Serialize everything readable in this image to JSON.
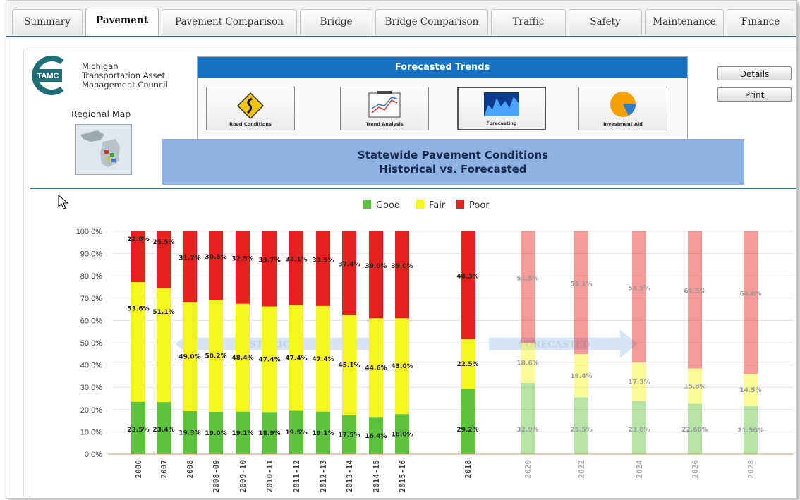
{
  "tabs": [
    "Summary",
    "Pavement",
    "Pavement Comparison",
    "Bridge",
    "Bridge Comparison",
    "Traffic",
    "Safety",
    "Maintenance",
    "Finance"
  ],
  "active_tab": "Pavement",
  "org": {
    "logo_text": "TAMC",
    "line1": "Michigan",
    "line2": "Transportation Asset",
    "line3": "Management Council"
  },
  "regional_map_label": "Regional Map",
  "trends": {
    "title": "Forecasted Trends",
    "buttons": [
      "Road Conditions",
      "Trend Analysis",
      "Forecasting",
      "Investment Aid"
    ]
  },
  "buttons": {
    "details": "Details",
    "print": "Print"
  },
  "statewide": {
    "line1": "Statewide Pavement Conditions",
    "line2": "Historical vs. Forecasted"
  },
  "colors": {
    "good": "#5cc43a",
    "fair": "#f6f61e",
    "poor": "#e8211f",
    "tab_accent": "#2d6b7c",
    "trend_header": "#1471c2",
    "state_bar": "#8fb3e3"
  },
  "chart_data": {
    "type": "bar",
    "stacked": true,
    "categories": [
      "2006",
      "2007",
      "2008",
      "2008-09",
      "2009-10",
      "2010-11",
      "2011-12",
      "2012-13",
      "2013-14",
      "2014-15",
      "2015-16",
      "2018",
      "2020",
      "2022",
      "2024",
      "2026",
      "2028"
    ],
    "series": [
      {
        "name": "Good",
        "values": [
          23.5,
          23.4,
          19.3,
          19.0,
          19.1,
          18.9,
          19.5,
          19.1,
          17.5,
          16.4,
          18.0,
          29.2,
          32.9,
          25.5,
          23.8,
          22.6,
          21.5
        ]
      },
      {
        "name": "Fair",
        "values": [
          53.6,
          51.1,
          49.0,
          50.2,
          48.4,
          47.4,
          47.4,
          47.4,
          45.1,
          44.6,
          43.0,
          22.5,
          18.6,
          19.4,
          17.3,
          15.8,
          14.5
        ]
      },
      {
        "name": "Poor",
        "values": [
          22.8,
          25.5,
          31.7,
          30.8,
          32.5,
          33.7,
          33.1,
          33.5,
          37.4,
          39.0,
          39.0,
          48.3,
          51.5,
          55.1,
          58.9,
          61.5,
          64.0
        ]
      }
    ],
    "value_labels": {
      "Good": [
        "23.5%",
        "23.4%",
        "19.3%",
        "19.0%",
        "19.1%",
        "18.9%",
        "19.5%",
        "19.1%",
        "17.5%",
        "16.4%",
        "18.0%",
        "29.2%",
        "32.9%",
        "25.5%",
        "23.8%",
        "22.60%",
        "21.50%"
      ],
      "Fair": [
        "53.6%",
        "51.1%",
        "49.0%",
        "50.2%",
        "48.4%",
        "47.4%",
        "47.4%",
        "47.4%",
        "45.1%",
        "44.6%",
        "43.0%",
        "22.5%",
        "18.6%",
        "19.4%",
        "17.3%",
        "15.8%",
        "14.5%"
      ],
      "Poor": [
        "22.8%",
        "25.5%",
        "31.7%",
        "30.8%",
        "32.5%",
        "33.7%",
        "33.1%",
        "33.5%",
        "37.4%",
        "39.0%",
        "39.0%",
        "48.3%",
        "51.5%",
        "55.1%",
        "58.9%",
        "61.5%",
        "64.0%"
      ]
    },
    "forecast_start_index": 12,
    "ylim": [
      0,
      100
    ],
    "yticks": [
      "0.0%",
      "10.0%",
      "20.0%",
      "30.0%",
      "40.0%",
      "50.0%",
      "60.0%",
      "70.0%",
      "80.0%",
      "90.0%",
      "100.0%"
    ],
    "annotations": [
      "HISTORICAL",
      "FORECASTED"
    ],
    "legend_position": "top-center"
  }
}
